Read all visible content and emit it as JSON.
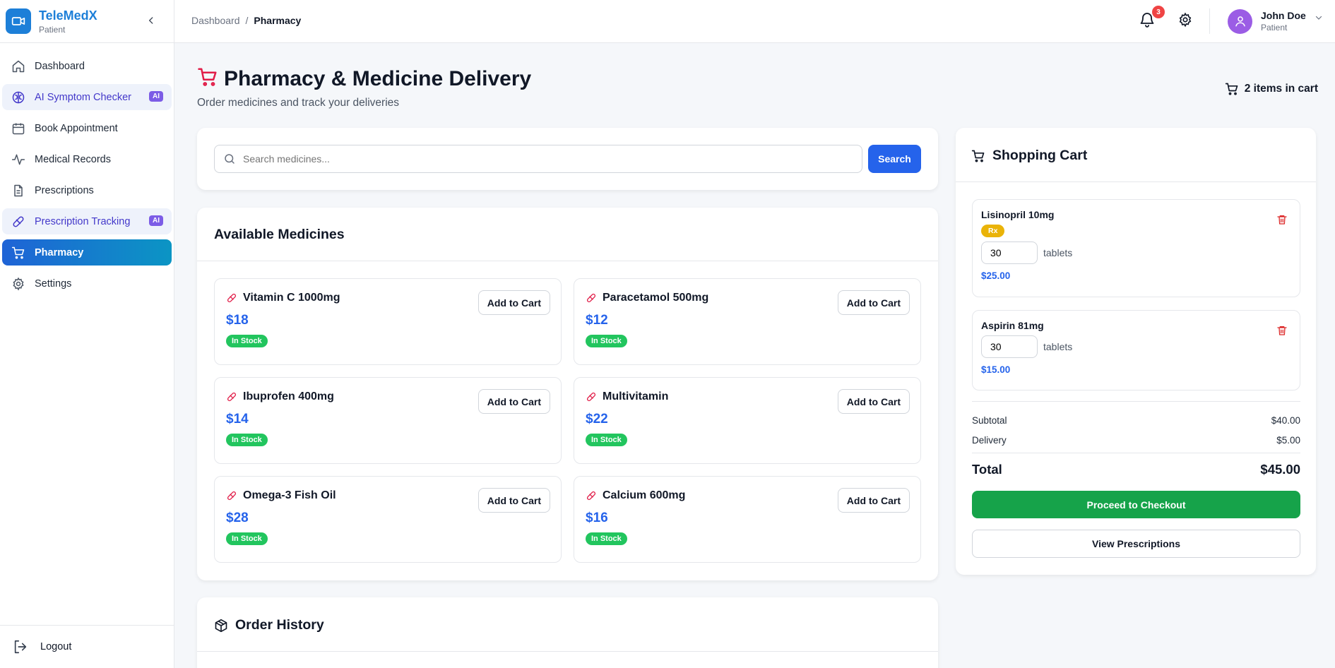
{
  "brand": {
    "name": "TeleMedX",
    "role": "Patient",
    "logo_icon": "video-camera-icon",
    "color": "#1d7fd8"
  },
  "sidebar": {
    "items": [
      {
        "label": "Dashboard",
        "icon": "home-icon"
      },
      {
        "label": "AI Symptom Checker",
        "icon": "brain-icon",
        "badge": "AI"
      },
      {
        "label": "Book Appointment",
        "icon": "calendar-icon"
      },
      {
        "label": "Medical Records",
        "icon": "activity-icon"
      },
      {
        "label": "Prescriptions",
        "icon": "file-text-icon"
      },
      {
        "label": "Prescription Tracking",
        "icon": "pill-icon",
        "badge": "AI"
      },
      {
        "label": "Pharmacy",
        "icon": "cart-icon",
        "active": true
      },
      {
        "label": "Settings",
        "icon": "gear-icon"
      }
    ],
    "logout_label": "Logout"
  },
  "header": {
    "breadcrumb": {
      "parent": "Dashboard",
      "separator": "/",
      "current": "Pharmacy"
    },
    "notifications_count": "3",
    "user": {
      "name": "John Doe",
      "role": "Patient"
    }
  },
  "page": {
    "title": "Pharmacy & Medicine Delivery",
    "subtitle": "Order medicines and track your deliveries",
    "cart_count_label": "2 items in cart"
  },
  "search": {
    "placeholder": "Search medicines...",
    "button_label": "Search"
  },
  "medicines": {
    "title": "Available Medicines",
    "add_label": "Add to Cart",
    "items": [
      {
        "name": "Vitamin C 1000mg",
        "price": "$18",
        "stock": "In Stock"
      },
      {
        "name": "Paracetamol 500mg",
        "price": "$12",
        "stock": "In Stock"
      },
      {
        "name": "Ibuprofen 400mg",
        "price": "$14",
        "stock": "In Stock"
      },
      {
        "name": "Multivitamin",
        "price": "$22",
        "stock": "In Stock"
      },
      {
        "name": "Omega-3 Fish Oil",
        "price": "$28",
        "stock": "In Stock"
      },
      {
        "name": "Calcium 600mg",
        "price": "$16",
        "stock": "In Stock"
      }
    ]
  },
  "order_history": {
    "title": "Order History"
  },
  "cart": {
    "title": "Shopping Cart",
    "items": [
      {
        "name": "Lisinopril 10mg",
        "badge": "Rx",
        "qty": "30",
        "unit": "tablets",
        "price": "$25.00"
      },
      {
        "name": "Aspirin 81mg",
        "qty": "30",
        "unit": "tablets",
        "price": "$15.00"
      }
    ],
    "subtotal_label": "Subtotal",
    "subtotal": "$40.00",
    "delivery_label": "Delivery",
    "delivery": "$5.00",
    "total_label": "Total",
    "total": "$45.00",
    "checkout_label": "Proceed to Checkout",
    "view_rx_label": "View Prescriptions"
  },
  "colors": {
    "primary": "#2563eb",
    "success": "#22c55e",
    "checkout": "#16a34a",
    "danger": "#ef4444",
    "rx": "#eab308",
    "ai_badge": "#7c5ce6"
  }
}
